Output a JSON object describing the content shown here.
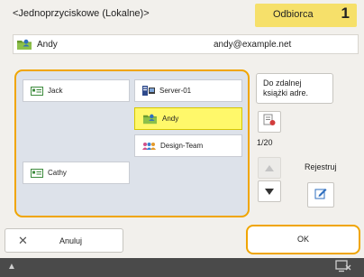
{
  "header": {
    "title": "<Jednoprzyciskowe (Lokalne)>",
    "recipient_label": "Odbiorca",
    "recipient_count": "1"
  },
  "selected": {
    "name": "Andy",
    "email": "andy@example.net"
  },
  "entries": [
    {
      "label": "Jack",
      "icon": "contact-card-icon",
      "selected": false
    },
    {
      "label": "Server-01",
      "icon": "server-icon",
      "selected": false
    },
    {
      "label": "Andy",
      "icon": "folder-person-icon",
      "selected": true
    },
    {
      "label": "Design-Team",
      "icon": "group-icon",
      "selected": false
    },
    {
      "label": "Cathy",
      "icon": "contact-card-icon",
      "selected": false
    }
  ],
  "right_panel": {
    "book_line1": "Do zdalnej",
    "book_line2": "książki adre.",
    "page_indicator": "1/20",
    "register_label": "Rejestruj"
  },
  "footer": {
    "cancel_label": "Anuluj",
    "ok_label": "OK"
  },
  "colors": {
    "accent": "#f0a500",
    "selected": "#fff86a",
    "badge": "#f6e06a"
  }
}
